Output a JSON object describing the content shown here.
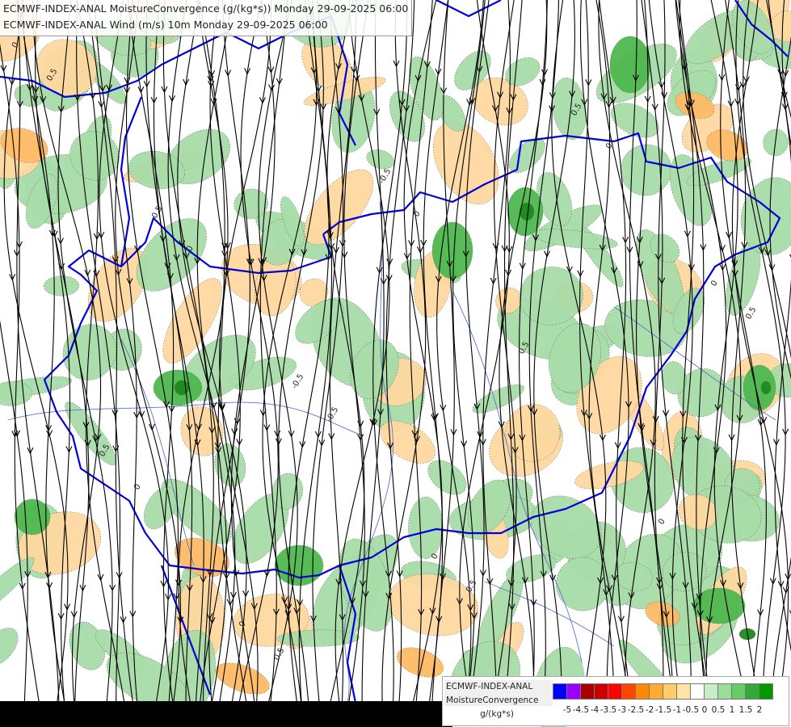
{
  "titles": {
    "line1": "ECMWF-INDEX-ANAL MoistureConvergence (g/(kg*s)) Monday 29-09-2025 06:00",
    "line2": "ECMWF-INDEX-ANAL Wind (m/s) 10m Monday 29-09-2025 06:00"
  },
  "legend": {
    "product_line1": "ECMWF-INDEX-ANAL",
    "product_line2": "MoistureConvergence",
    "units": "g/(kg*s)",
    "colors": [
      "#0000ff",
      "#9900ff",
      "#aa0000",
      "#cc0000",
      "#ff0000",
      "#ff4400",
      "#ff8800",
      "#ffaa33",
      "#ffcc66",
      "#ffe4a8",
      "#ffffff",
      "#c8eec8",
      "#99dd99",
      "#66cc66",
      "#33aa33",
      "#009900"
    ],
    "tick_labels": [
      "-5",
      "-4.5",
      "-4",
      "-3.5",
      "-3",
      "-2.5",
      "-2",
      "-1.5",
      "-1",
      "-0.5",
      "0",
      "0.5",
      "1",
      "1.5",
      "2"
    ]
  },
  "map": {
    "field_colors": {
      "positive": "#a8dca8",
      "positive_strong": "#4fb84f",
      "positive_max": "#1e8a1e",
      "negative": "#ffd9a0",
      "negative_strong": "#ffbb66"
    },
    "border_color": "#0000dd",
    "river_color": "#5577cc",
    "streamline_color": "#000000",
    "contour_labels": [
      "0",
      "0.5",
      "-0.5",
      "0",
      "0.5",
      "0",
      "0.5",
      "0",
      "-0.5",
      "0.5",
      "0",
      "0.5",
      "0",
      "-0.5",
      "0.5",
      "0",
      "0.5",
      "0",
      "0.5",
      "0"
    ]
  }
}
